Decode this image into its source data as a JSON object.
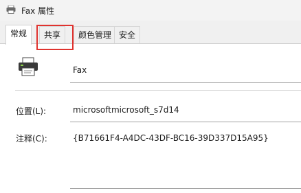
{
  "window": {
    "title": "Fax 属性"
  },
  "tabs": [
    {
      "label": "常规"
    },
    {
      "label": "共享"
    },
    {
      "label": "颜色管理"
    },
    {
      "label": "安全"
    }
  ],
  "general": {
    "printer_name": "Fax",
    "location_label": "位置(L):",
    "location_value": "microsoftmicrosoft_s7d14",
    "comment_label": "注释(C):",
    "comment_value": "{B71661F4-A4DC-43DF-BC16-39D337D15A95}"
  },
  "colors": {
    "highlight": "#e0332f"
  }
}
